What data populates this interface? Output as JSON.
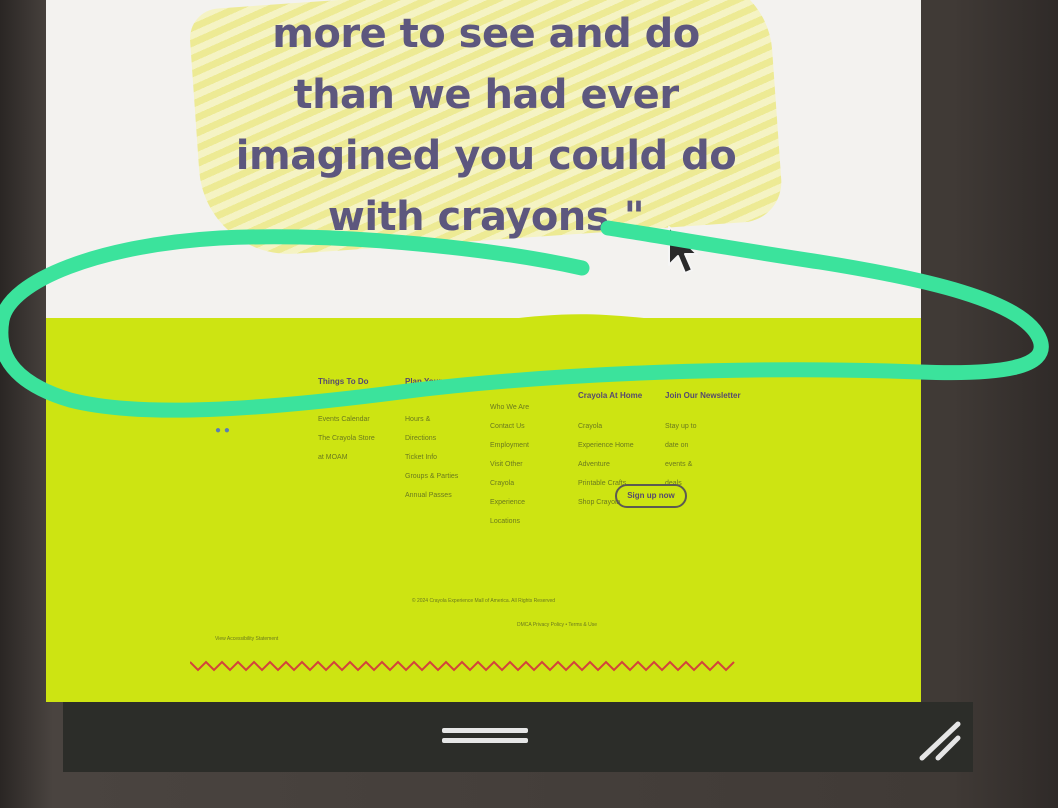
{
  "quote": {
    "lines": [
      "more to see and do",
      "than we had ever",
      "imagined you could do",
      "with crayons.\""
    ]
  },
  "footer": {
    "columns": [
      {
        "heading": "Things To Do",
        "links": [
          "Events Calendar",
          "The Crayola Store",
          "at MOAM"
        ]
      },
      {
        "heading": "Plan Your",
        "links": [
          "Hours &",
          "Directions",
          "Ticket Info",
          "Groups & Parties",
          "Annual Passes"
        ]
      },
      {
        "heading": "",
        "links": [
          "Who We Are",
          "Contact Us",
          "Employment",
          "Visit Other",
          "Crayola",
          "Experience",
          "Locations"
        ]
      },
      {
        "heading": "Crayola At Home",
        "links": [
          "Crayola",
          "Experience Home",
          "Adventure",
          "Printable Crafts",
          "Shop Crayola"
        ]
      },
      {
        "heading": "Join Our Newsletter",
        "links": [
          "Stay up to",
          "date on",
          "events &",
          "deals"
        ]
      }
    ],
    "signup_label": "Sign up now",
    "copyright": "© 2024 Crayola Experience Mall of America. All Rights Reserved",
    "legal": "DMCA Privacy Policy • Terms & Use",
    "accessibility": "View Accessibility Statement"
  },
  "colors": {
    "quote_text": "#5d577e",
    "footer_bg": "#cde412",
    "marker": "#3be39c",
    "zigzag": "#d2433c"
  },
  "icons": [
    "social-icons",
    "mouse-pointer-icon",
    "window-handle-icon",
    "resize-grip-icon"
  ]
}
